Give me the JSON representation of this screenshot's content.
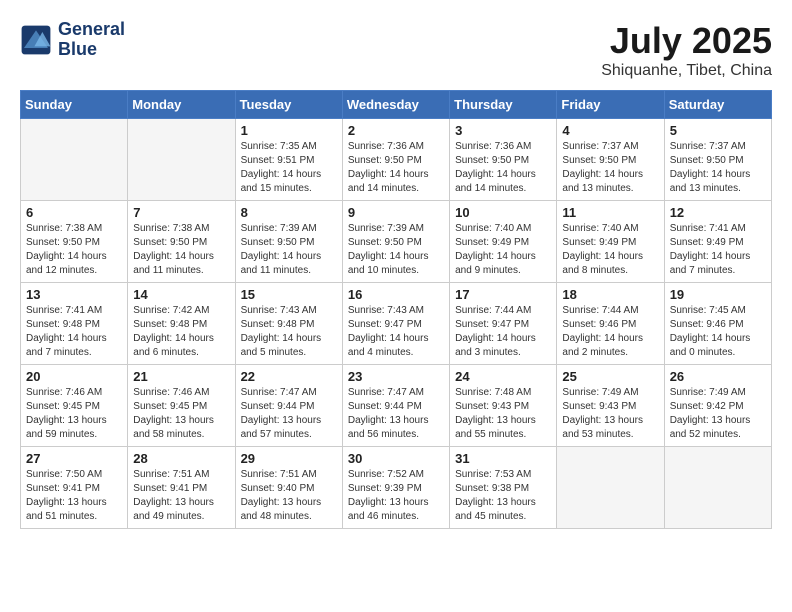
{
  "header": {
    "logo_line1": "General",
    "logo_line2": "Blue",
    "month_title": "July 2025",
    "location": "Shiquanhe, Tibet, China"
  },
  "days_of_week": [
    "Sunday",
    "Monday",
    "Tuesday",
    "Wednesday",
    "Thursday",
    "Friday",
    "Saturday"
  ],
  "weeks": [
    [
      {
        "day": "",
        "info": ""
      },
      {
        "day": "",
        "info": ""
      },
      {
        "day": "1",
        "info": "Sunrise: 7:35 AM\nSunset: 9:51 PM\nDaylight: 14 hours\nand 15 minutes."
      },
      {
        "day": "2",
        "info": "Sunrise: 7:36 AM\nSunset: 9:50 PM\nDaylight: 14 hours\nand 14 minutes."
      },
      {
        "day": "3",
        "info": "Sunrise: 7:36 AM\nSunset: 9:50 PM\nDaylight: 14 hours\nand 14 minutes."
      },
      {
        "day": "4",
        "info": "Sunrise: 7:37 AM\nSunset: 9:50 PM\nDaylight: 14 hours\nand 13 minutes."
      },
      {
        "day": "5",
        "info": "Sunrise: 7:37 AM\nSunset: 9:50 PM\nDaylight: 14 hours\nand 13 minutes."
      }
    ],
    [
      {
        "day": "6",
        "info": "Sunrise: 7:38 AM\nSunset: 9:50 PM\nDaylight: 14 hours\nand 12 minutes."
      },
      {
        "day": "7",
        "info": "Sunrise: 7:38 AM\nSunset: 9:50 PM\nDaylight: 14 hours\nand 11 minutes."
      },
      {
        "day": "8",
        "info": "Sunrise: 7:39 AM\nSunset: 9:50 PM\nDaylight: 14 hours\nand 11 minutes."
      },
      {
        "day": "9",
        "info": "Sunrise: 7:39 AM\nSunset: 9:50 PM\nDaylight: 14 hours\nand 10 minutes."
      },
      {
        "day": "10",
        "info": "Sunrise: 7:40 AM\nSunset: 9:49 PM\nDaylight: 14 hours\nand 9 minutes."
      },
      {
        "day": "11",
        "info": "Sunrise: 7:40 AM\nSunset: 9:49 PM\nDaylight: 14 hours\nand 8 minutes."
      },
      {
        "day": "12",
        "info": "Sunrise: 7:41 AM\nSunset: 9:49 PM\nDaylight: 14 hours\nand 7 minutes."
      }
    ],
    [
      {
        "day": "13",
        "info": "Sunrise: 7:41 AM\nSunset: 9:48 PM\nDaylight: 14 hours\nand 7 minutes."
      },
      {
        "day": "14",
        "info": "Sunrise: 7:42 AM\nSunset: 9:48 PM\nDaylight: 14 hours\nand 6 minutes."
      },
      {
        "day": "15",
        "info": "Sunrise: 7:43 AM\nSunset: 9:48 PM\nDaylight: 14 hours\nand 5 minutes."
      },
      {
        "day": "16",
        "info": "Sunrise: 7:43 AM\nSunset: 9:47 PM\nDaylight: 14 hours\nand 4 minutes."
      },
      {
        "day": "17",
        "info": "Sunrise: 7:44 AM\nSunset: 9:47 PM\nDaylight: 14 hours\nand 3 minutes."
      },
      {
        "day": "18",
        "info": "Sunrise: 7:44 AM\nSunset: 9:46 PM\nDaylight: 14 hours\nand 2 minutes."
      },
      {
        "day": "19",
        "info": "Sunrise: 7:45 AM\nSunset: 9:46 PM\nDaylight: 14 hours\nand 0 minutes."
      }
    ],
    [
      {
        "day": "20",
        "info": "Sunrise: 7:46 AM\nSunset: 9:45 PM\nDaylight: 13 hours\nand 59 minutes."
      },
      {
        "day": "21",
        "info": "Sunrise: 7:46 AM\nSunset: 9:45 PM\nDaylight: 13 hours\nand 58 minutes."
      },
      {
        "day": "22",
        "info": "Sunrise: 7:47 AM\nSunset: 9:44 PM\nDaylight: 13 hours\nand 57 minutes."
      },
      {
        "day": "23",
        "info": "Sunrise: 7:47 AM\nSunset: 9:44 PM\nDaylight: 13 hours\nand 56 minutes."
      },
      {
        "day": "24",
        "info": "Sunrise: 7:48 AM\nSunset: 9:43 PM\nDaylight: 13 hours\nand 55 minutes."
      },
      {
        "day": "25",
        "info": "Sunrise: 7:49 AM\nSunset: 9:43 PM\nDaylight: 13 hours\nand 53 minutes."
      },
      {
        "day": "26",
        "info": "Sunrise: 7:49 AM\nSunset: 9:42 PM\nDaylight: 13 hours\nand 52 minutes."
      }
    ],
    [
      {
        "day": "27",
        "info": "Sunrise: 7:50 AM\nSunset: 9:41 PM\nDaylight: 13 hours\nand 51 minutes."
      },
      {
        "day": "28",
        "info": "Sunrise: 7:51 AM\nSunset: 9:41 PM\nDaylight: 13 hours\nand 49 minutes."
      },
      {
        "day": "29",
        "info": "Sunrise: 7:51 AM\nSunset: 9:40 PM\nDaylight: 13 hours\nand 48 minutes."
      },
      {
        "day": "30",
        "info": "Sunrise: 7:52 AM\nSunset: 9:39 PM\nDaylight: 13 hours\nand 46 minutes."
      },
      {
        "day": "31",
        "info": "Sunrise: 7:53 AM\nSunset: 9:38 PM\nDaylight: 13 hours\nand 45 minutes."
      },
      {
        "day": "",
        "info": ""
      },
      {
        "day": "",
        "info": ""
      }
    ]
  ]
}
